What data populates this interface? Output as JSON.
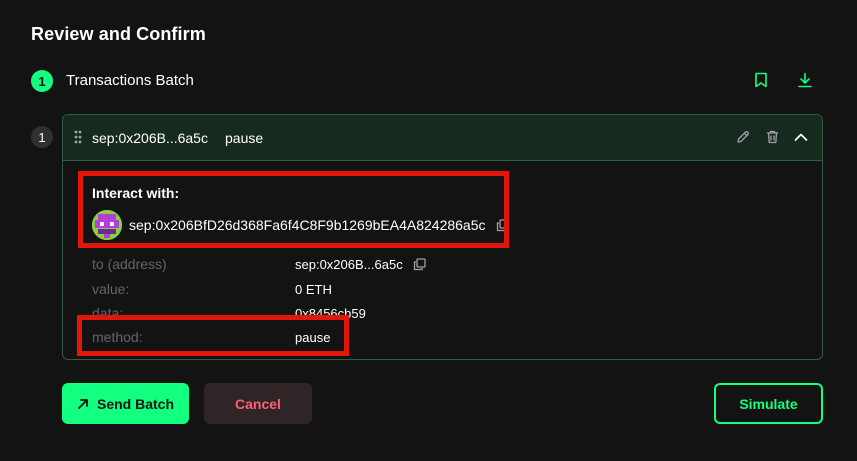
{
  "page": {
    "title": "Review and Confirm"
  },
  "batch": {
    "step_number": "1",
    "title": "Transactions Batch",
    "icons": {
      "bookmark": "bookmark-icon",
      "download": "download-icon"
    }
  },
  "transaction": {
    "index": "1",
    "header_address": "sep:0x206B...6a5c",
    "header_method": "pause",
    "interact_label": "Interact with:",
    "full_address": "sep:0x206BfD26d368Fa6f4C8F9b1269bEA4A824286a5c",
    "details": [
      {
        "label": "to (address)",
        "value": "sep:0x206B...6a5c"
      },
      {
        "label": "value:",
        "value": "0 ETH"
      },
      {
        "label": "data:",
        "value": "0x8456cb59"
      },
      {
        "label": "method:",
        "value": "pause"
      }
    ]
  },
  "actions": {
    "send_label": "Send Batch",
    "cancel_label": "Cancel",
    "simulate_label": "Simulate"
  },
  "colors": {
    "background": "#121312",
    "accent": "#12ff80",
    "card_border": "#2f5c43",
    "cancel_text": "#ff5f72",
    "annotation_red": "#e1170c"
  }
}
